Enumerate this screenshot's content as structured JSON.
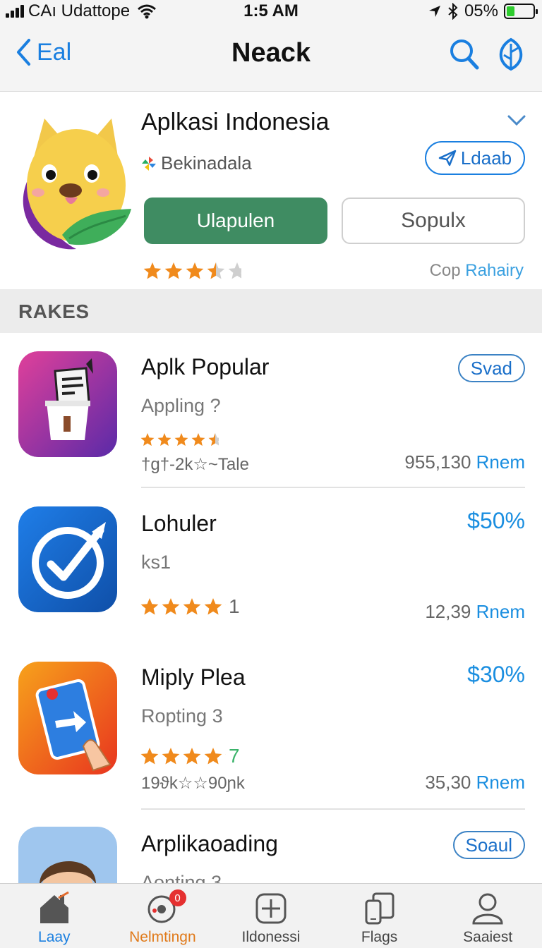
{
  "status_bar": {
    "carrier": "CAı Udattope",
    "time": "1:5 AM",
    "battery": "05%"
  },
  "nav": {
    "back_label": "Eal",
    "title": "Neack"
  },
  "featured": {
    "title": "Aplkasi Indonesia",
    "developer": "Bekinadala",
    "badge_label": "Ldaab",
    "primary_button": "Ulapulen",
    "secondary_button": "Sopulx",
    "rating": 3.5,
    "link_prefix": "Cop",
    "link_label": "Rahairy"
  },
  "section": {
    "title": "RAKES"
  },
  "apps": [
    {
      "name": "Aplk Popular",
      "subtitle": "Appling ?",
      "rating": 4.5,
      "meta": "†ɡ†-2k☆~Tale",
      "count": "955,130",
      "unit": "Rnem",
      "action": "Svad",
      "icon": "clipboard-icon"
    },
    {
      "name": "Lohuler",
      "subtitle": "ks1",
      "rating": 4.5,
      "extra": "1",
      "count": "12,39",
      "unit": "Rnem",
      "price": "$50%",
      "icon": "check-circle-icon"
    },
    {
      "name": "Miply Plea",
      "subtitle": "Ropting 3",
      "rating": 4.5,
      "extra": "7",
      "meta": "19ϑk☆☆90ɲk",
      "count": "35,30",
      "unit": "Rnem",
      "price": "$30%",
      "icon": "tap-arrow-icon"
    },
    {
      "name": "Arplikaoading",
      "subtitle": "Aonting 3",
      "action": "Soaul",
      "icon": "avatar-icon"
    }
  ],
  "tabs": [
    {
      "label": "Laay",
      "icon": "home-icon"
    },
    {
      "label": "Nelmtingn",
      "icon": "disc-icon",
      "badge": "0"
    },
    {
      "label": "Ildonessi",
      "icon": "plus-square-icon"
    },
    {
      "label": "Flags",
      "icon": "devices-icon"
    },
    {
      "label": "Saaiest",
      "icon": "person-icon"
    }
  ],
  "colors": {
    "accent": "#1a7fe0",
    "primary_button": "#3f8c62",
    "star": "#f08a1c",
    "badge": "#e53030"
  }
}
